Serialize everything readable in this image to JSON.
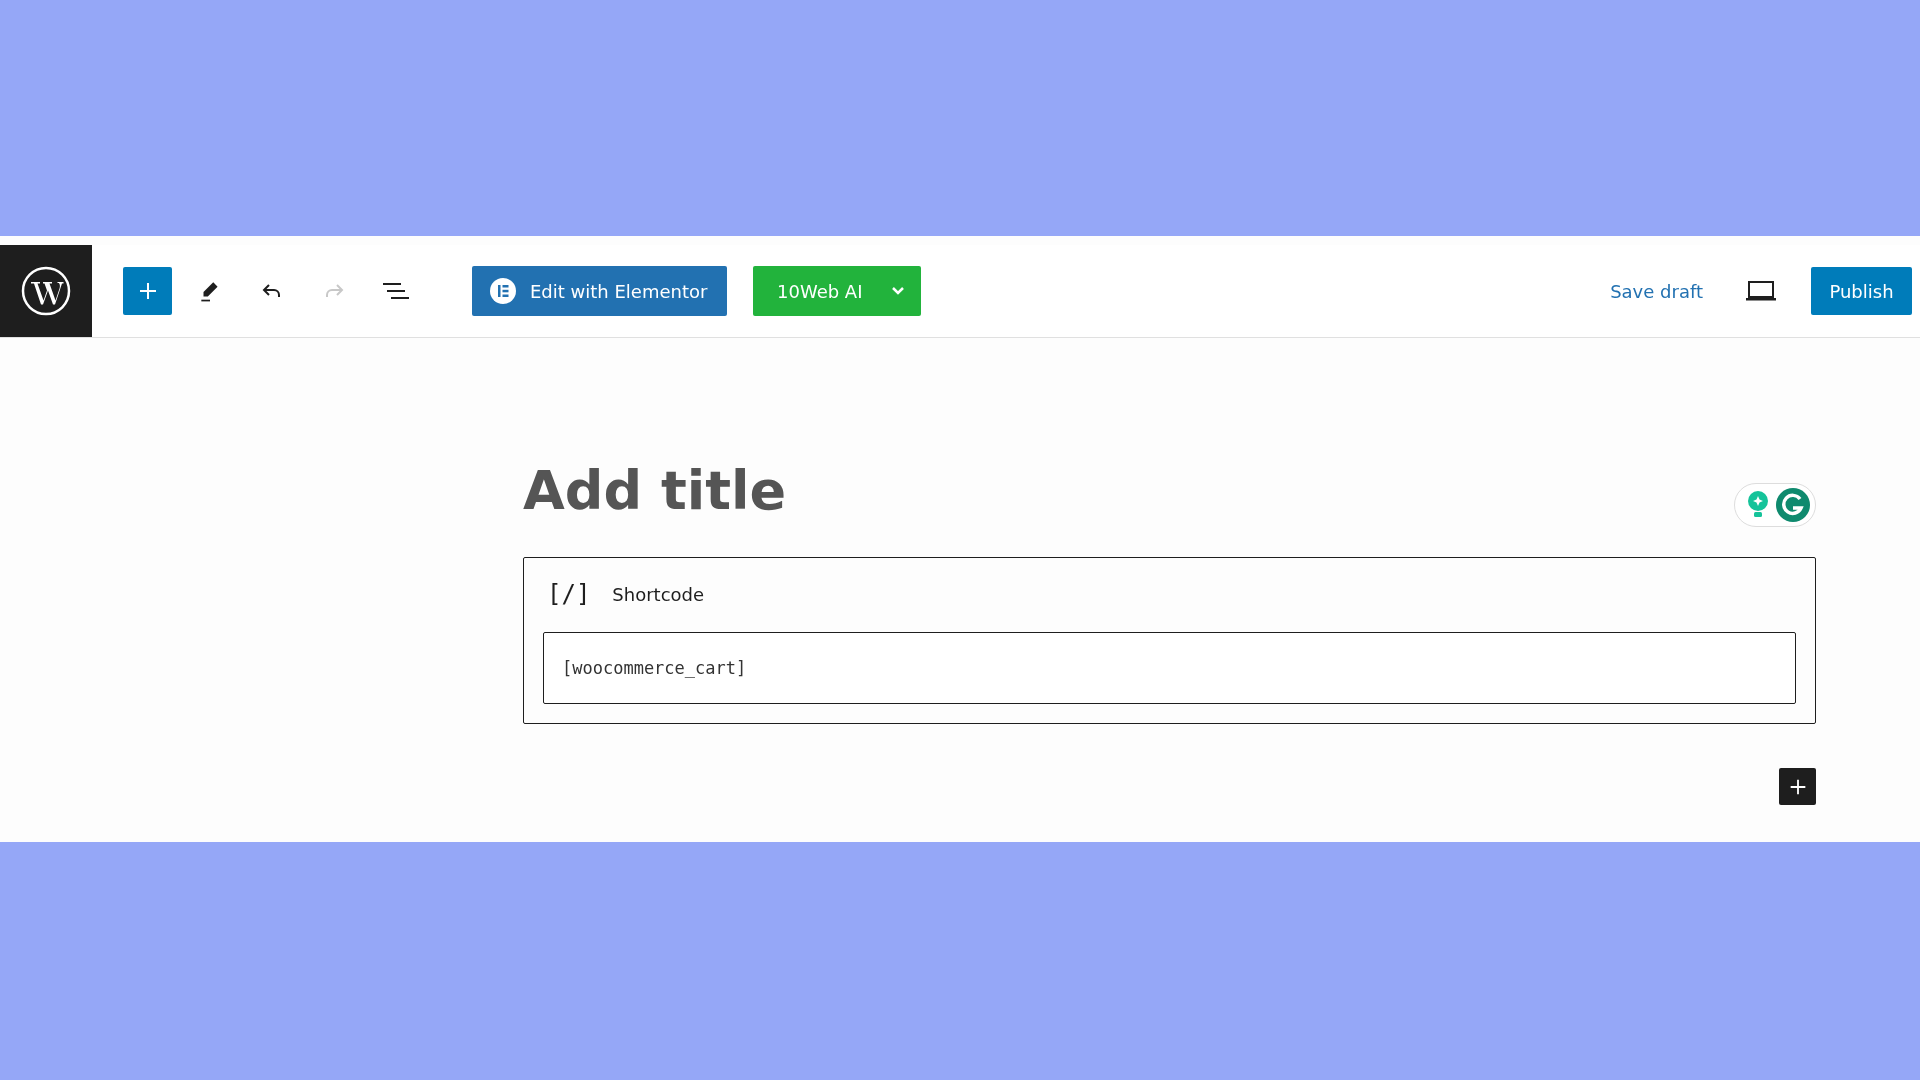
{
  "toolbar": {
    "tools": [
      {
        "kind": "inserter",
        "disabled": false
      },
      {
        "kind": "edit",
        "disabled": false
      },
      {
        "kind": "undo",
        "disabled": false
      },
      {
        "kind": "redo",
        "disabled": true
      },
      {
        "kind": "outline",
        "disabled": false
      }
    ],
    "elementor_button": "Edit with Elementor",
    "ai_button": "10Web AI",
    "save_draft": "Save draft",
    "publish": "Publish"
  },
  "editor": {
    "title_placeholder": "Add title",
    "block": {
      "icon": "[/]",
      "label": "Shortcode",
      "value": "[woocommerce_cart]"
    }
  }
}
